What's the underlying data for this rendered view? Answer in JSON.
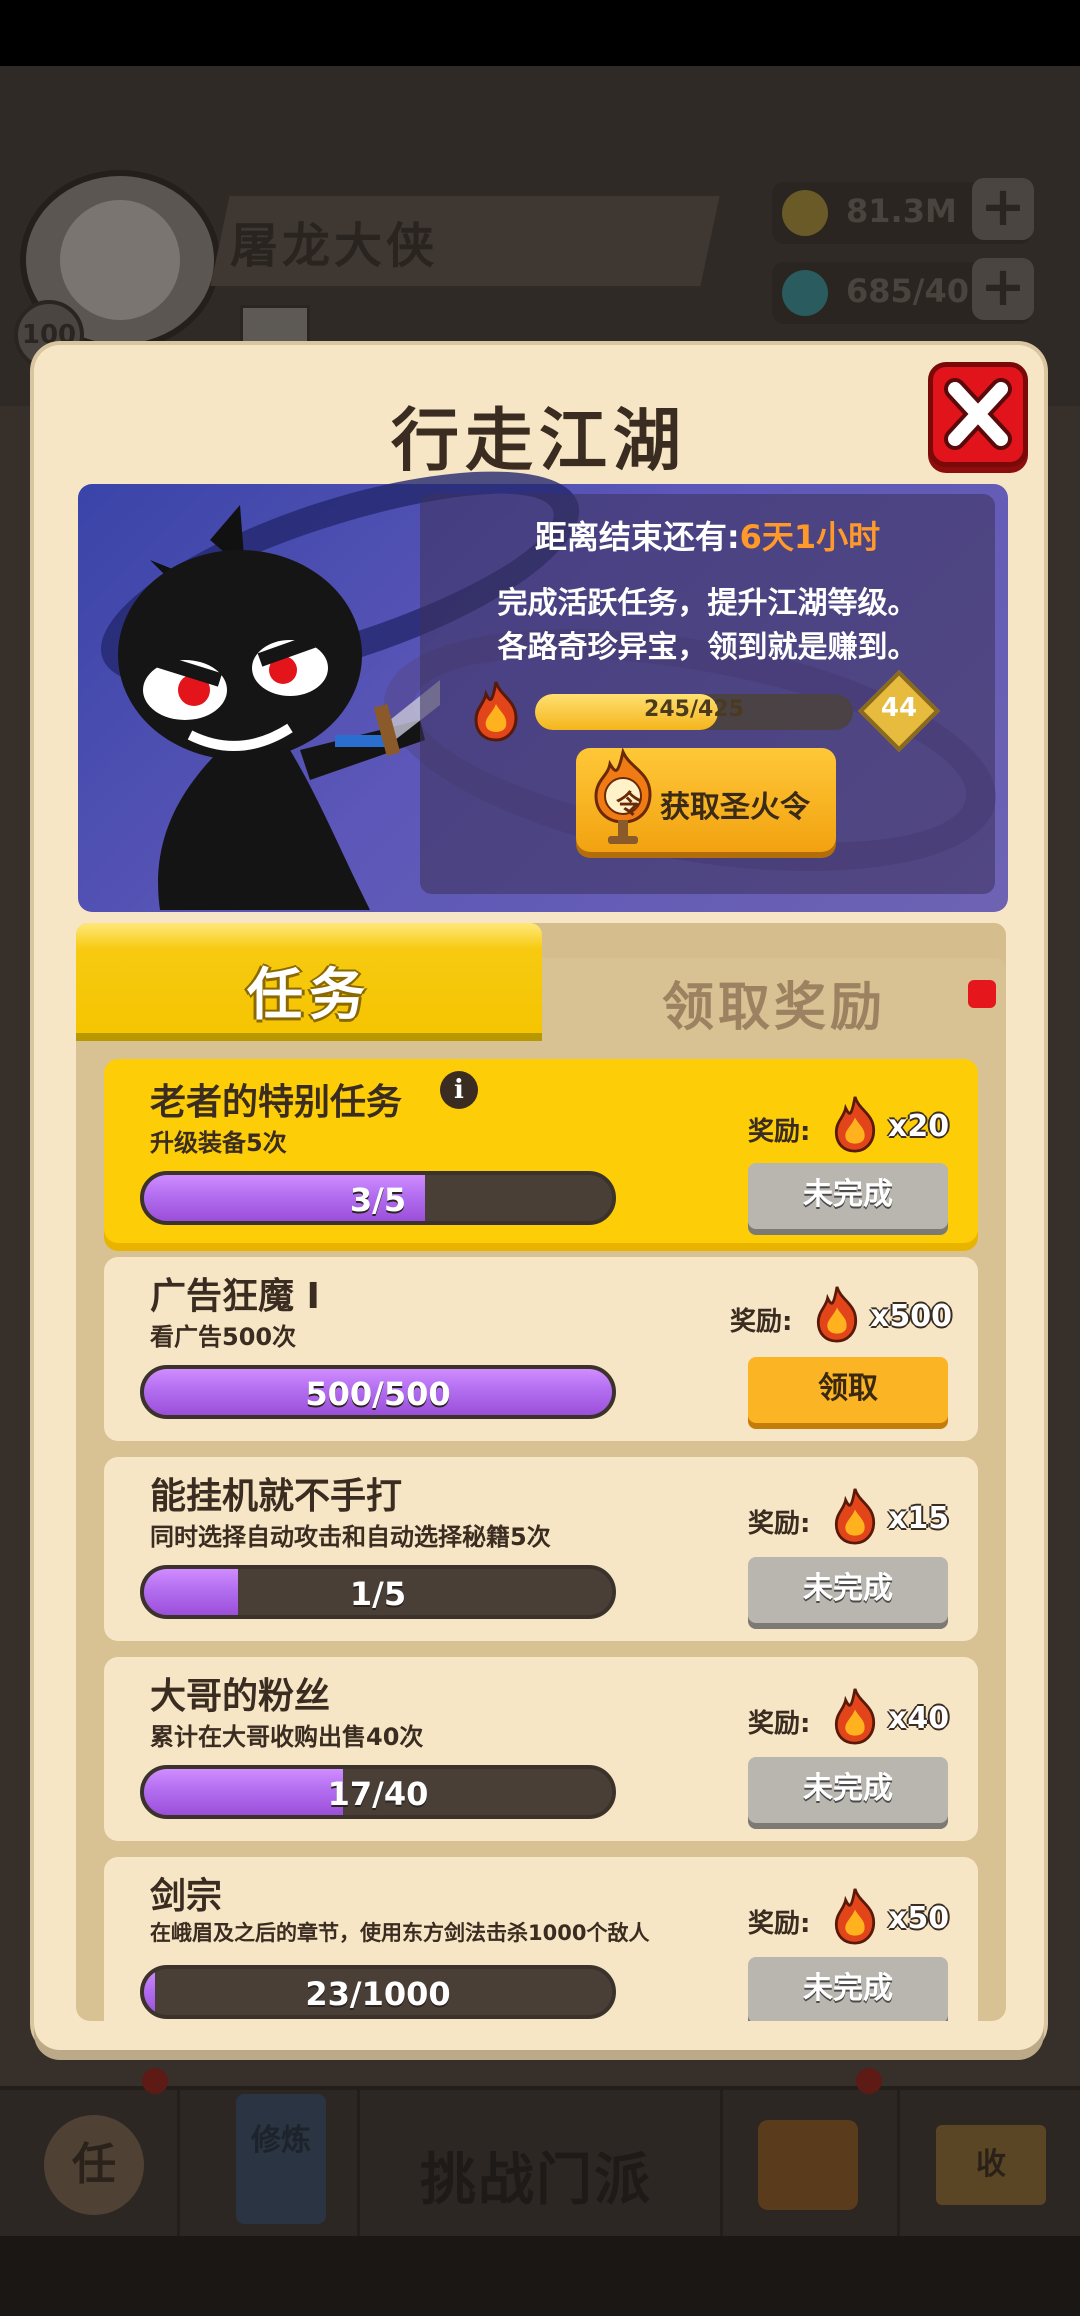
{
  "player": {
    "name": "屠龙大侠",
    "level": "100",
    "gold": "81.3M",
    "gems": "685/40"
  },
  "bottom_nav": {
    "challenge_label": "挑战门派",
    "task_icon_text": "任",
    "training_icon_text": "修炼",
    "shop_icon_text": "收"
  },
  "modal": {
    "title": "行走江湖",
    "countdown_label": "距离结束还有:",
    "countdown_value": "6天1小时",
    "desc_line1": "完成活跃任务，提升江湖等级。",
    "desc_line2": "各路奇珍异宝，领到就是赚到。",
    "exp_text": "245/425",
    "exp_fraction": 0.576,
    "level": "44",
    "token_button": "获取圣火令",
    "token_icon_char": "令"
  },
  "tabs": {
    "tasks": "任务",
    "rewards": "领取奖励"
  },
  "reward_label": "奖励:",
  "tasks": [
    {
      "title": "老者的特别任务",
      "subtitle": "升级装备5次",
      "progress_text": "3/5",
      "progress": 0.6,
      "reward_qty": "x20",
      "button": "未完成",
      "status": "incomplete"
    },
    {
      "title": "广告狂魔 I",
      "subtitle": "看广告500次",
      "progress_text": "500/500",
      "progress": 1.0,
      "reward_qty": "x500",
      "button": "领取",
      "status": "claim"
    },
    {
      "title": "能挂机就不手打",
      "subtitle": "同时选择自动攻击和自动选择秘籍5次",
      "progress_text": "1/5",
      "progress": 0.2,
      "reward_qty": "x15",
      "button": "未完成",
      "status": "incomplete"
    },
    {
      "title": "大哥的粉丝",
      "subtitle": "累计在大哥收购出售40次",
      "progress_text": "17/40",
      "progress": 0.425,
      "reward_qty": "x40",
      "button": "未完成",
      "status": "incomplete"
    },
    {
      "title": "剑宗",
      "subtitle": "在峨眉及之后的章节，使用东方剑法击杀1000个敌人",
      "progress_text": "23/1000",
      "progress": 0.023,
      "reward_qty": "x50",
      "button": "未完成",
      "status": "incomplete"
    }
  ],
  "colors": {
    "modal_bg": "#f6e6c5",
    "tab_active": "#f5c400",
    "progress_purple": "#b36ef0",
    "close_red": "#e0141a",
    "claim_orange": "#fbb524",
    "countdown_orange": "#ff9a2a"
  }
}
